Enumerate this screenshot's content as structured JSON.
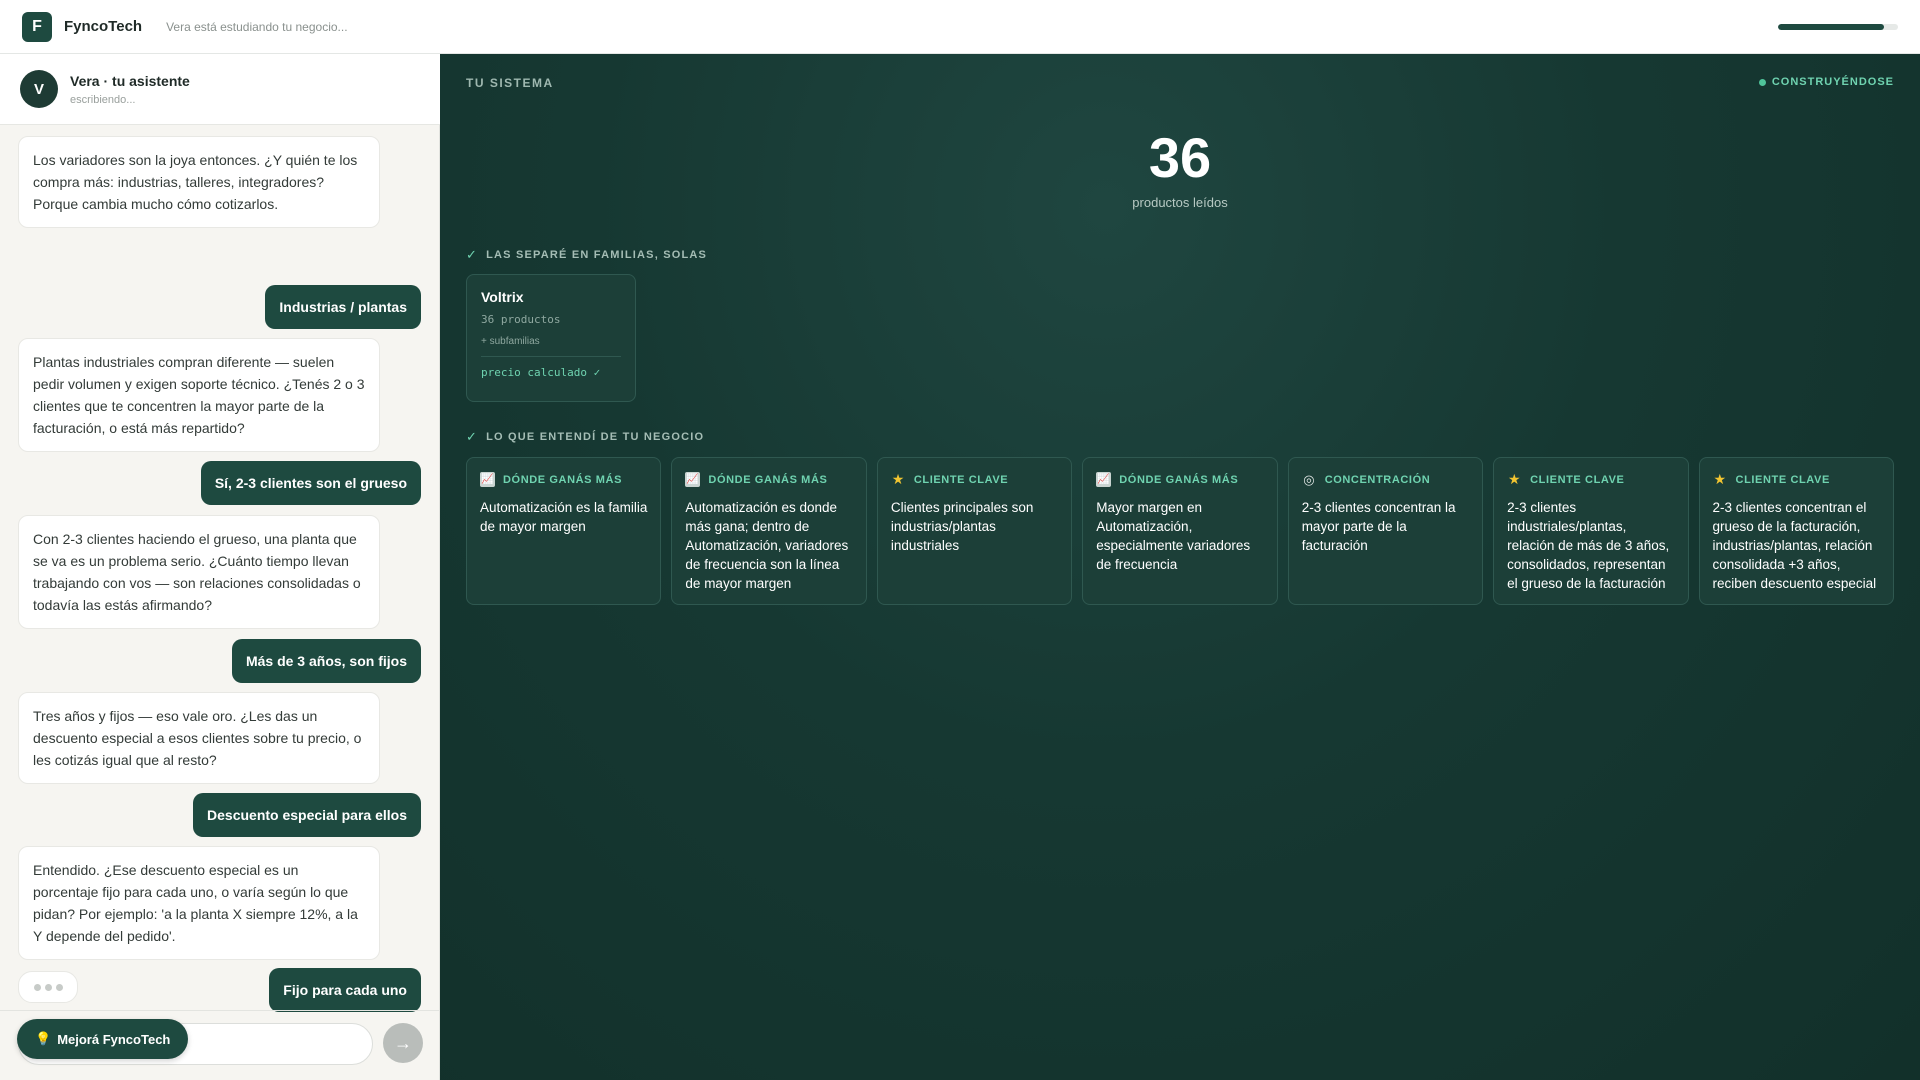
{
  "topbar": {
    "logo_letter": "F",
    "brand": "FyncoTech",
    "status": "Vera está estudiando tu negocio...",
    "progress": 0.88
  },
  "chat": {
    "assistant_initial": "V",
    "assistant_name": "Vera · tu asistente",
    "assistant_status": "escribiendo...",
    "messages": [
      {
        "role": "bot",
        "text": "Los variadores son la joya entonces. ¿Y quién te los compra más: industrias, talleres, integradores? Porque cambia mucho cómo cotizarlos."
      },
      {
        "role": "user",
        "text": "Industrias / plantas"
      },
      {
        "role": "bot",
        "text": "Plantas industriales compran diferente — suelen pedir volumen y exigen soporte técnico. ¿Tenés 2 o 3 clientes que te concentren la mayor parte de la facturación, o está más repartido?"
      },
      {
        "role": "user",
        "text": "Sí, 2-3 clientes son el grueso"
      },
      {
        "role": "bot",
        "text": "Con 2-3 clientes haciendo el grueso, una planta que se va es un problema serio. ¿Cuánto tiempo llevan trabajando con vos — son relaciones consolidadas o todavía las estás afirmando?"
      },
      {
        "role": "user",
        "text": "Más de 3 años, son fijos"
      },
      {
        "role": "bot",
        "text": "Tres años y fijos — eso vale oro. ¿Les das un descuento especial a esos clientes sobre tu precio, o les cotizás igual que al resto?"
      },
      {
        "role": "user",
        "text": "Descuento especial para ellos"
      },
      {
        "role": "bot",
        "text": "Entendido. ¿Ese descuento especial es un porcentaje fijo para cada uno, o varía según lo que pidan? Por ejemplo: 'a la planta X siempre 12%, a la Y depende del pedido'."
      },
      {
        "role": "user",
        "text": "Fijo para cada uno"
      }
    ],
    "improve_label": "Mejorá FyncoTech",
    "improve_icon": "lightbulb-icon",
    "send_icon": "arrow-right-icon"
  },
  "system": {
    "title": "TU SISTEMA",
    "status": "CONSTRUYÉNDOSE",
    "products_count": "36",
    "products_caption": "productos leídos",
    "families_label": "LAS SEPARÉ EN FAMILIAS, SOLAS",
    "family": {
      "name": "Voltrix",
      "count": "36 productos",
      "sub": "+ subfamilias",
      "price": "precio calculado ✓"
    },
    "understood_label": "LO QUE ENTENDÍ DE TU NEGOCIO",
    "insights": [
      {
        "icon": "chart",
        "category": "DÓNDE GANÁS MÁS",
        "text": "Automatización es la familia de mayor margen"
      },
      {
        "icon": "chart",
        "category": "DÓNDE GANÁS MÁS",
        "text": "Automatización es donde más gana; dentro de Automatización, variadores de frecuencia son la línea de mayor margen"
      },
      {
        "icon": "star",
        "category": "CLIENTE CLAVE",
        "text": "Clientes principales son industrias/plantas industriales"
      },
      {
        "icon": "chart",
        "category": "DÓNDE GANÁS MÁS",
        "text": "Mayor margen en Automatización, especialmente variadores de frecuencia"
      },
      {
        "icon": "target",
        "category": "CONCENTRACIÓN",
        "text": "2-3 clientes concentran la mayor parte de la facturación"
      },
      {
        "icon": "star",
        "category": "CLIENTE CLAVE",
        "text": "2-3 clientes industriales/plantas, relación de más de 3 años, consolidados, representan el grueso de la facturación"
      },
      {
        "icon": "star",
        "category": "CLIENTE CLAVE",
        "text": "2-3 clientes concentran el grueso de la facturación, industrias/plantas, relación consolidada +3 años, reciben descuento especial"
      }
    ]
  }
}
